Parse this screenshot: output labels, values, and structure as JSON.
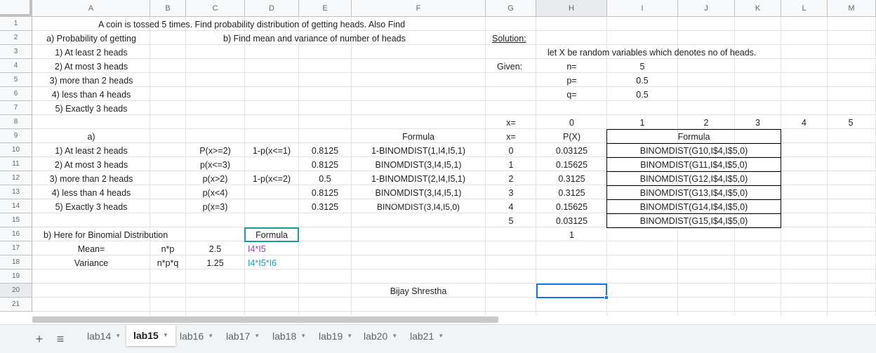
{
  "columns": [
    "A",
    "B",
    "C",
    "D",
    "E",
    "F",
    "G",
    "H",
    "I",
    "J",
    "K",
    "L",
    "M"
  ],
  "rows": [
    "1",
    "2",
    "3",
    "4",
    "5",
    "6",
    "7",
    "8",
    "9",
    "10",
    "11",
    "12",
    "13",
    "14",
    "15",
    "16",
    "17",
    "18",
    "19",
    "20",
    "21"
  ],
  "selected": {
    "column": "H",
    "row": "20"
  },
  "cells": {
    "title": "A coin is tossed 5 times. Find probability distribution of getting heads. Also Find",
    "a_prob": "a) Probability of getting",
    "b_find": "b) Find mean and variance of number of heads",
    "solution": "Solution:",
    "q1": "1) At least 2 heads",
    "q2": "2) At most 3 heads",
    "q3": "3) more than 2 heads",
    "q4": "4) less than 4 heads",
    "q5": "5) Exactly 3 heads",
    "let_x": "let X be random variables which denotes no of heads.",
    "given": "Given:",
    "n_lbl": "n=",
    "n_val": "5",
    "p_lbl": "p=",
    "p_val": "0.5",
    "q_lbl": "q=",
    "q_val": "0.5",
    "x_lbl8": "x=",
    "x_vals": [
      "0",
      "1",
      "2",
      "3",
      "4",
      "5"
    ],
    "a_hdr": "a)",
    "formula_hdr": "Formula",
    "x_lbl9": "x=",
    "px_hdr": "P(X)",
    "formula_hdr2": "Formula",
    "rows_a": [
      {
        "q": "1) At least 2 heads",
        "expr": "P(x>=2)",
        "comp": "1-p(x<=1)",
        "val": "0.8125",
        "formula": "1-BINOMDIST(1,I4,I5,1)"
      },
      {
        "q": "2) At most 3 heads",
        "expr": "p(x<=3)",
        "comp": "",
        "val": "0.8125",
        "formula": "BINOMDIST(3,I4,I5,1)"
      },
      {
        "q": "3) more than 2 heads",
        "expr": "p(x>2)",
        "comp": "1-p(x<=2)",
        "val": "0.5",
        "formula": "1-BINOMDIST(2,I4,I5,1)"
      },
      {
        "q": "4) less than 4 heads",
        "expr": "p(x<4)",
        "comp": "",
        "val": "0.8125",
        "formula": "BINOMDIST(3,I4,I5,1)"
      },
      {
        "q": "5) Exactly 3 heads",
        "expr": "p(x=3)",
        "comp": "",
        "val": "0.3125",
        "formula": "BINOMDIST(3,I4,I5,0)"
      }
    ],
    "dist_rows": [
      {
        "x": "0",
        "px": "0.03125",
        "formula": "BINOMDIST(G10,I$4,I$5,0)"
      },
      {
        "x": "1",
        "px": "0.15625",
        "formula": "BINOMDIST(G11,I$4,I$5,0)"
      },
      {
        "x": "2",
        "px": "0.3125",
        "formula": "BINOMDIST(G12,I$4,I$5,0)"
      },
      {
        "x": "3",
        "px": "0.3125",
        "formula": "BINOMDIST(G13,I$4,I$5,0)"
      },
      {
        "x": "4",
        "px": "0.15625",
        "formula": "BINOMDIST(G14,I$4,I$5,0)"
      },
      {
        "x": "5",
        "px": "0.03125",
        "formula": "BINOMDIST(G15,I$4,I$5,0)"
      }
    ],
    "b_here": "b) Here for Binomial Distribution",
    "formula_b": "Formula",
    "sum_px": "1",
    "mean_lbl": "Mean=",
    "mean_expr": "n*p",
    "mean_val": "2.5",
    "mean_formula": "I4*I5",
    "var_lbl": "Variance",
    "var_expr": "n*p*q",
    "var_val": "1.25",
    "var_formula": "I4*I5*I6",
    "author": "Bijay Shrestha"
  },
  "tabs": [
    {
      "label": "lab14",
      "active": false
    },
    {
      "label": "lab15",
      "active": true
    },
    {
      "label": "lab16",
      "active": false
    },
    {
      "label": "lab17",
      "active": false
    },
    {
      "label": "lab18",
      "active": false
    },
    {
      "label": "lab19",
      "active": false
    },
    {
      "label": "lab20",
      "active": false
    },
    {
      "label": "lab21",
      "active": false
    }
  ],
  "icons": {
    "add_sheet": "plus-icon",
    "all_sheets": "menu-icon"
  },
  "colors": {
    "formula_border": "#1a9fa0",
    "selection": "#1a73e8",
    "purple_text": "#8e44ad",
    "teal_text": "#16a2b8"
  }
}
